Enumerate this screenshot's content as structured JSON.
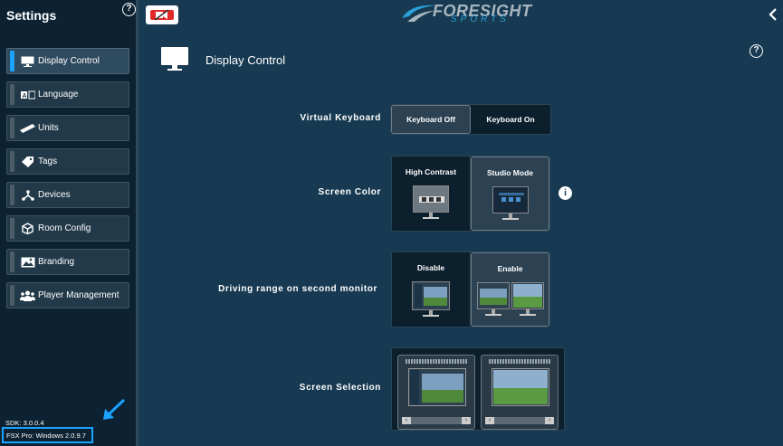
{
  "sidebar": {
    "title": "Settings",
    "help_glyph": "?",
    "items": [
      {
        "label": "Display Control",
        "icon": "monitor-icon",
        "active": true
      },
      {
        "label": "Language",
        "icon": "language-icon",
        "active": false
      },
      {
        "label": "Units",
        "icon": "ruler-icon",
        "active": false
      },
      {
        "label": "Tags",
        "icon": "tag-icon",
        "active": false
      },
      {
        "label": "Devices",
        "icon": "devices-icon",
        "active": false
      },
      {
        "label": "Room Config",
        "icon": "cube-icon",
        "active": false
      },
      {
        "label": "Branding",
        "icon": "image-icon",
        "active": false
      },
      {
        "label": "Player Management",
        "icon": "players-icon",
        "active": false
      }
    ],
    "sdk": "SDK: 3.0.0.4",
    "fsx": "FSX Pro: Windows 2.0.9.7"
  },
  "header": {
    "logo_main": "FORESIGHT",
    "logo_sub": "SPORTS",
    "back_icon": "chevron-left-icon",
    "toggle_icon": "camera-toggle-icon"
  },
  "page": {
    "title": "Display Control",
    "help_glyph": "?"
  },
  "settings": {
    "virtual_keyboard": {
      "label": "Virtual Keyboard",
      "options": [
        "Keyboard Off",
        "Keyboard On"
      ],
      "selected": "Keyboard Off"
    },
    "screen_color": {
      "label": "Screen Color",
      "options": [
        "High Contrast",
        "Studio Mode"
      ],
      "selected": "Studio Mode",
      "info_glyph": "i"
    },
    "driving_range": {
      "label": "Driving range on second monitor",
      "options": [
        "Disable",
        "Enable"
      ],
      "selected": "Enable"
    },
    "screen_selection": {
      "label": "Screen Selection"
    }
  },
  "colors": {
    "accent": "#1aa3ff",
    "background": "#173a52",
    "sidebar": "#0c2232"
  }
}
